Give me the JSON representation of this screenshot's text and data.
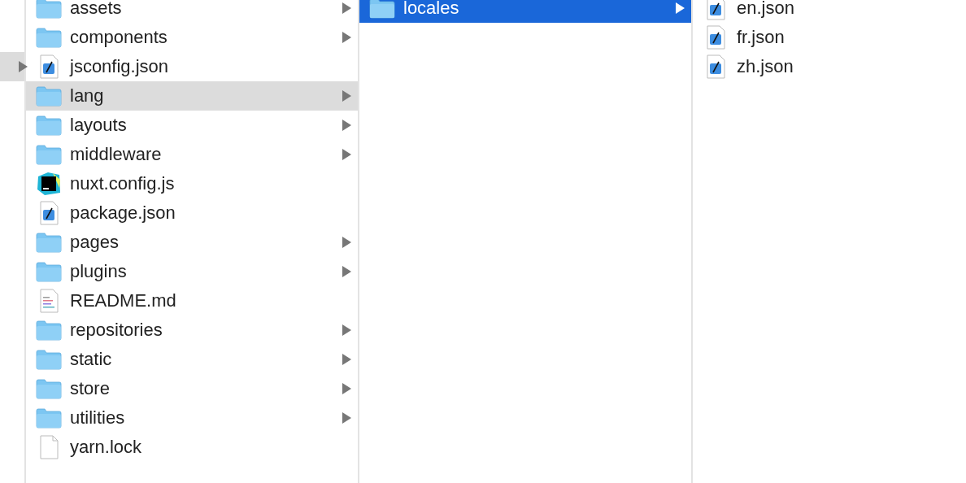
{
  "columns": [
    {
      "focused": false,
      "items": [
        {
          "expandable": true,
          "selected": true
        }
      ]
    },
    {
      "focused": false,
      "items": [
        {
          "name": "assets",
          "kind": "folder",
          "expandable": true,
          "selected": false
        },
        {
          "name": "components",
          "kind": "folder",
          "expandable": true,
          "selected": false
        },
        {
          "name": "jsconfig.json",
          "kind": "json",
          "expandable": false,
          "selected": false
        },
        {
          "name": "lang",
          "kind": "folder",
          "expandable": true,
          "selected": true
        },
        {
          "name": "layouts",
          "kind": "folder",
          "expandable": true,
          "selected": false
        },
        {
          "name": "middleware",
          "kind": "folder",
          "expandable": true,
          "selected": false
        },
        {
          "name": "nuxt.config.js",
          "kind": "webstorm",
          "expandable": false,
          "selected": false
        },
        {
          "name": "package.json",
          "kind": "json",
          "expandable": false,
          "selected": false
        },
        {
          "name": "pages",
          "kind": "folder",
          "expandable": true,
          "selected": false
        },
        {
          "name": "plugins",
          "kind": "folder",
          "expandable": true,
          "selected": false
        },
        {
          "name": "README.md",
          "kind": "text",
          "expandable": false,
          "selected": false
        },
        {
          "name": "repositories",
          "kind": "folder",
          "expandable": true,
          "selected": false
        },
        {
          "name": "static",
          "kind": "folder",
          "expandable": true,
          "selected": false
        },
        {
          "name": "store",
          "kind": "folder",
          "expandable": true,
          "selected": false
        },
        {
          "name": "utilities",
          "kind": "folder",
          "expandable": true,
          "selected": false
        },
        {
          "name": "yarn.lock",
          "kind": "blank",
          "expandable": false,
          "selected": false
        }
      ]
    },
    {
      "focused": true,
      "items": [
        {
          "name": "locales",
          "kind": "folder",
          "expandable": true,
          "selected": true
        }
      ]
    },
    {
      "items": [
        {
          "name": "en.json",
          "kind": "json",
          "expandable": false,
          "selected": false
        },
        {
          "name": "fr.json",
          "kind": "json",
          "expandable": false,
          "selected": false
        },
        {
          "name": "zh.json",
          "kind": "json",
          "expandable": false,
          "selected": false
        }
      ]
    }
  ]
}
